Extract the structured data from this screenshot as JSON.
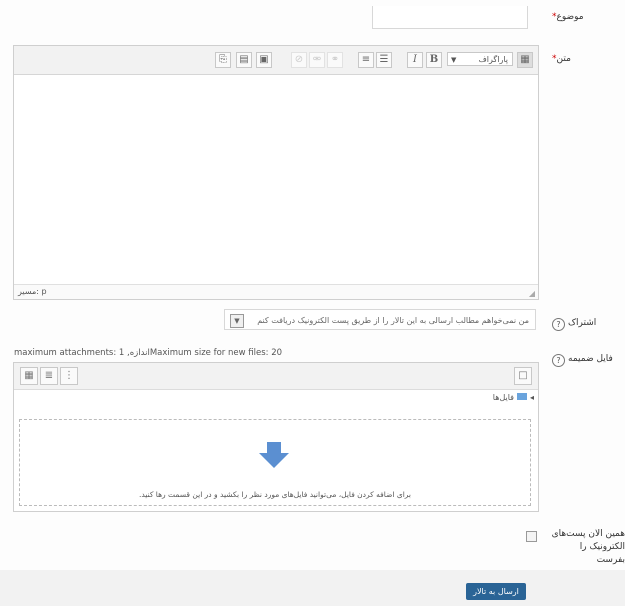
{
  "subject": {
    "label": "موضوع",
    "required_mark": "*"
  },
  "message": {
    "label": "متن",
    "required_mark": "*",
    "format_select": "پاراگراف",
    "buttons": [
      "bold",
      "italic",
      "unordered-list",
      "ordered-list",
      "link",
      "unlink",
      "no-link",
      "image",
      "media",
      "manage-files"
    ],
    "bold_label": "B",
    "italic_label": "I",
    "path_label": "مسیر: p"
  },
  "subscription": {
    "label": "اشتراک",
    "option": "من نمی‌خواهم مطالب ارسالی به این تالار را از طریق پست الکترونیک دریافت کنم"
  },
  "attachment": {
    "label": "فایل ضمیمه",
    "info": "maximum attachments: 1 ,اندازه‌Maximum size for new files: 20",
    "folder_label": "فایل‌ها",
    "drop_text": "برای اضافه کردن فایل، می‌توانید فایل‌های مورد نظر را بکشید و در این قسمت رها کنید."
  },
  "mail_now": {
    "label_line1": "همین الان پست‌های",
    "label_line2": "الکترونیک را بفرست"
  },
  "submit": {
    "label": "ارسال به تالار"
  },
  "colors": {
    "accent": "#2a6496",
    "required": "#cc0000",
    "drop_arrow": "#5b8fd1"
  }
}
